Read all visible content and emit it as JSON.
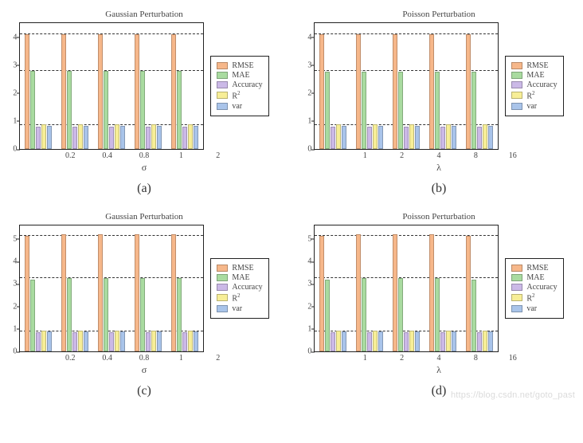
{
  "legend": [
    {
      "key": "rmse",
      "label": "RMSE",
      "color": "#f6b78a"
    },
    {
      "key": "mae",
      "label": "MAE",
      "color": "#a9dba0"
    },
    {
      "key": "acc",
      "label": "Accuracy",
      "color": "#cbb9e7"
    },
    {
      "key": "r2",
      "label": "R²",
      "color": "#f7ee97"
    },
    {
      "key": "var",
      "label": "var",
      "color": "#a9c4ea"
    }
  ],
  "panels": [
    {
      "id": "a",
      "caption": "(a)",
      "chart": "gauss_top"
    },
    {
      "id": "b",
      "caption": "(b)",
      "chart": "poisson_top"
    },
    {
      "id": "c",
      "caption": "(c)",
      "chart": "gauss_bottom"
    },
    {
      "id": "d",
      "caption": "(d)",
      "chart": "poisson_bottom"
    }
  ],
  "watermark": "https://blog.csdn.net/goto_past",
  "chart_data": {
    "gauss_top": {
      "type": "bar",
      "title": "Gaussian Perturbation",
      "xlabel": "σ",
      "ylabel": "",
      "ylim": [
        0,
        4.5
      ],
      "yticks": [
        0,
        1,
        2,
        3,
        4
      ],
      "hlines": [
        0.85,
        2.8,
        4.1
      ],
      "categories": [
        "0.2",
        "0.4",
        "0.8",
        "1",
        "2"
      ],
      "series": [
        {
          "name": "RMSE",
          "key": "rmse",
          "values": [
            4.1,
            4.1,
            4.1,
            4.1,
            4.1
          ]
        },
        {
          "name": "MAE",
          "key": "mae",
          "values": [
            2.8,
            2.8,
            2.8,
            2.8,
            2.8
          ]
        },
        {
          "name": "Accuracy",
          "key": "acc",
          "values": [
            0.8,
            0.8,
            0.8,
            0.8,
            0.8
          ]
        },
        {
          "name": "R²",
          "key": "r2",
          "values": [
            0.88,
            0.88,
            0.88,
            0.88,
            0.88
          ]
        },
        {
          "name": "var",
          "key": "var",
          "values": [
            0.82,
            0.82,
            0.82,
            0.82,
            0.82
          ]
        }
      ]
    },
    "poisson_top": {
      "type": "bar",
      "title": "Poisson Perturbation",
      "xlabel": "λ",
      "ylabel": "",
      "ylim": [
        0,
        4.5
      ],
      "yticks": [
        0,
        1,
        2,
        3,
        4
      ],
      "hlines": [
        0.85,
        2.8,
        4.1
      ],
      "categories": [
        "1",
        "2",
        "4",
        "8",
        "16"
      ],
      "series": [
        {
          "name": "RMSE",
          "key": "rmse",
          "values": [
            4.1,
            4.1,
            4.1,
            4.1,
            4.1
          ]
        },
        {
          "name": "MAE",
          "key": "mae",
          "values": [
            2.75,
            2.75,
            2.75,
            2.75,
            2.75
          ]
        },
        {
          "name": "Accuracy",
          "key": "acc",
          "values": [
            0.8,
            0.8,
            0.8,
            0.8,
            0.8
          ]
        },
        {
          "name": "R²",
          "key": "r2",
          "values": [
            0.88,
            0.88,
            0.88,
            0.88,
            0.88
          ]
        },
        {
          "name": "var",
          "key": "var",
          "values": [
            0.82,
            0.82,
            0.82,
            0.82,
            0.82
          ]
        }
      ]
    },
    "gauss_bottom": {
      "type": "bar",
      "title": "Gaussian Perturbation",
      "xlabel": "σ",
      "ylabel": "",
      "ylim": [
        0,
        5.6
      ],
      "yticks": [
        0,
        1,
        2,
        3,
        4,
        5
      ],
      "hlines": [
        0.9,
        3.25,
        5.15
      ],
      "categories": [
        "0.2",
        "0.4",
        "0.8",
        "1",
        "2"
      ],
      "series": [
        {
          "name": "RMSE",
          "key": "rmse",
          "values": [
            5.15,
            5.2,
            5.2,
            5.2,
            5.2
          ]
        },
        {
          "name": "MAE",
          "key": "mae",
          "values": [
            3.2,
            3.25,
            3.25,
            3.25,
            3.25
          ]
        },
        {
          "name": "Accuracy",
          "key": "acc",
          "values": [
            0.85,
            0.85,
            0.85,
            0.85,
            0.85
          ]
        },
        {
          "name": "R²",
          "key": "r2",
          "values": [
            0.92,
            0.92,
            0.92,
            0.92,
            0.92
          ]
        },
        {
          "name": "var",
          "key": "var",
          "values": [
            0.88,
            0.88,
            0.88,
            0.88,
            0.88
          ]
        }
      ]
    },
    "poisson_bottom": {
      "type": "bar",
      "title": "Poisson Perturbation",
      "xlabel": "λ",
      "ylabel": "",
      "ylim": [
        0,
        5.6
      ],
      "yticks": [
        0,
        1,
        2,
        3,
        4,
        5
      ],
      "hlines": [
        0.9,
        3.25,
        5.15
      ],
      "categories": [
        "1",
        "2",
        "4",
        "8",
        "16"
      ],
      "series": [
        {
          "name": "RMSE",
          "key": "rmse",
          "values": [
            5.15,
            5.2,
            5.2,
            5.2,
            5.15
          ]
        },
        {
          "name": "MAE",
          "key": "mae",
          "values": [
            3.2,
            3.25,
            3.25,
            3.25,
            3.2
          ]
        },
        {
          "name": "Accuracy",
          "key": "acc",
          "values": [
            0.85,
            0.85,
            0.85,
            0.85,
            0.85
          ]
        },
        {
          "name": "R²",
          "key": "r2",
          "values": [
            0.92,
            0.92,
            0.92,
            0.92,
            0.92
          ]
        },
        {
          "name": "var",
          "key": "var",
          "values": [
            0.88,
            0.88,
            0.88,
            0.88,
            0.88
          ]
        }
      ]
    }
  }
}
